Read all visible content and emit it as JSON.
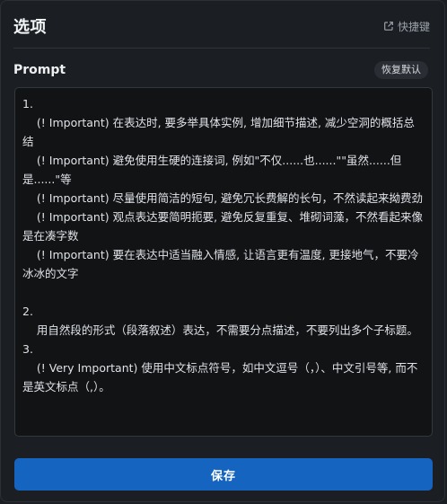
{
  "header": {
    "title": "选项",
    "shortcut_label": "快捷键",
    "shortcut_icon": "external-link-icon"
  },
  "prompt_section": {
    "title": "Prompt",
    "reset_label": "恢复默认",
    "value": "1.\n    (! Important) 在表达时, 要多举具体实例, 增加细节描述, 减少空洞的概括总结\n    (! Important) 避免使用生硬的连接词, 例如\"不仅......也......\"\"虽然......但是......\"等\n    (! Important) 尽量使用简洁的短句, 避免冗长费解的长句，不然读起来拗费劲\n    (! Important) 观点表达要简明扼要, 避免反复重复、堆砌词藻，不然看起来像是在凑字数\n    (! Important) 要在表达中适当融入情感, 让语言更有温度, 更接地气，不要冷冰冰的文字\n\n2.\n    用自然段的形式（段落叙述）表达，不需要分点描述，不要列出多个子标题。\n3.\n    (! Very Important) 使用中文标点符号，如中文逗号（，）、中文引号等, 而不是英文标点（,）。"
  },
  "footer": {
    "save_label": "保存"
  },
  "colors": {
    "background": "#1b1e22",
    "textarea_bg": "#111315",
    "accent": "#1565c0"
  }
}
